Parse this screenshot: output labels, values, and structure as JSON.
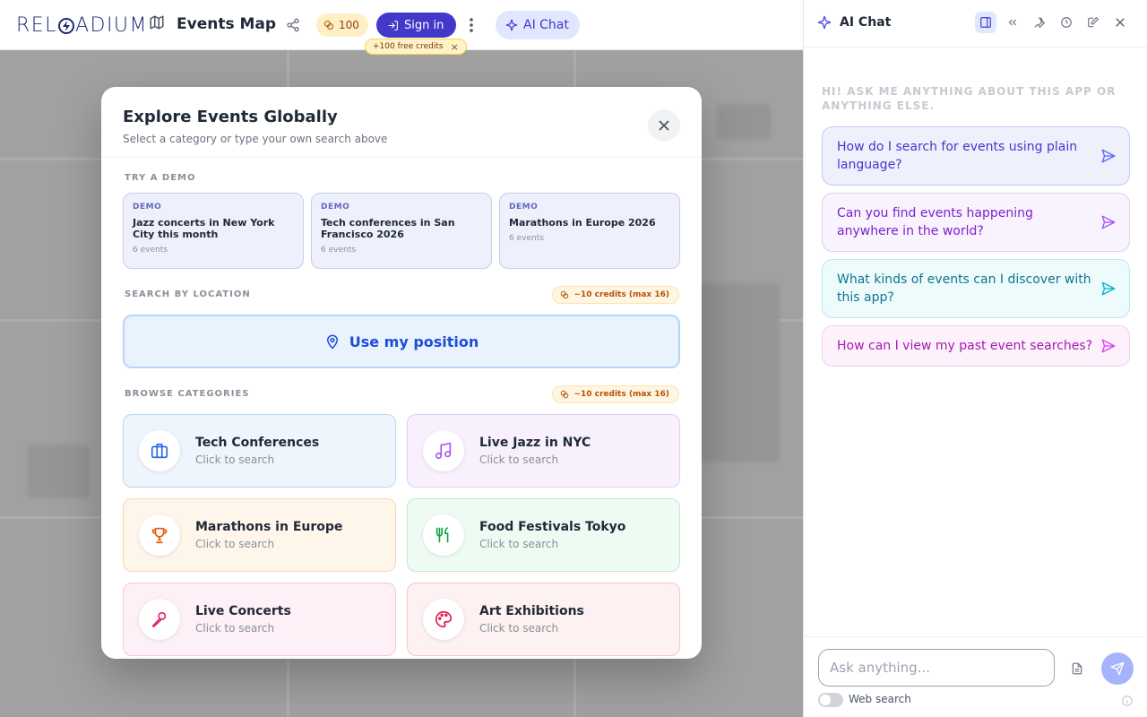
{
  "header": {
    "logo_text": "RELOADIUM",
    "app_title": "Events Map",
    "credits": "100",
    "signin_label": "Sign in",
    "aichat_label": "AI Chat",
    "promo_text": "+100 free credits",
    "promo_close": "×"
  },
  "modal": {
    "title": "Explore Events Globally",
    "subtitle": "Select a category or type your own search above",
    "demo_section_label": "TRY A DEMO",
    "demos": [
      {
        "tag": "DEMO",
        "name": "Jazz concerts in New York City this month",
        "count": "6 events"
      },
      {
        "tag": "DEMO",
        "name": "Tech conferences in San Francisco 2026",
        "count": "6 events"
      },
      {
        "tag": "DEMO",
        "name": "Marathons in Europe 2026",
        "count": "6 events"
      }
    ],
    "location_section_label": "SEARCH BY LOCATION",
    "location_credit_badge": "~10 credits (max 16)",
    "position_button": "Use my position",
    "categories_section_label": "BROWSE CATEGORIES",
    "categories_credit_badge": "~10 credits (max 16)",
    "categories": [
      {
        "name": "Tech Conferences",
        "hint": "Click to search",
        "icon": "briefcase-icon",
        "color": "#2563eb"
      },
      {
        "name": "Live Jazz in NYC",
        "hint": "Click to search",
        "icon": "music-icon",
        "color": "#a855f7"
      },
      {
        "name": "Marathons in Europe",
        "hint": "Click to search",
        "icon": "trophy-icon",
        "color": "#ea580c"
      },
      {
        "name": "Food Festivals Tokyo",
        "hint": "Click to search",
        "icon": "utensils-icon",
        "color": "#16a34a"
      },
      {
        "name": "Live Concerts",
        "hint": "Click to search",
        "icon": "microphone-icon",
        "color": "#db2777"
      },
      {
        "name": "Art Exhibitions",
        "hint": "Click to search",
        "icon": "palette-icon",
        "color": "#e11d48"
      }
    ]
  },
  "chat": {
    "title": "AI Chat",
    "intro": "Hi! Ask me anything about this app or anything else.",
    "suggestions": [
      {
        "text": "How do I search for events using plain language?",
        "color": "#4338ca"
      },
      {
        "text": "Can you find events happening anywhere in the world?",
        "color": "#7e22ce"
      },
      {
        "text": "What kinds of events can I discover with this app?",
        "color": "#0e7490"
      },
      {
        "text": "How can I view my past event searches?",
        "color": "#a21caf"
      }
    ],
    "input_placeholder": "Ask anything...",
    "web_search_label": "Web search"
  }
}
